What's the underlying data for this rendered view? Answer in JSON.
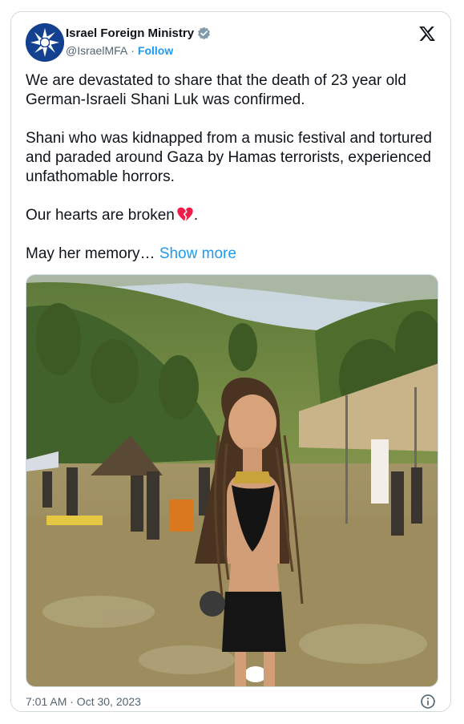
{
  "account": {
    "name": "Israel Foreign Ministry",
    "handle": "@IsraelMFA",
    "separator": "·",
    "follow_label": "Follow"
  },
  "tweet": {
    "paragraph1": "We are devastated to share that the death of 23 year old German-Israeli Shani Luk was confirmed.",
    "paragraph2": "Shani who was kidnapped from a music festival and tortured and paraded around Gaza by Hamas terrorists, experienced unfathomable horrors.",
    "paragraph3_text": "Our hearts are broken",
    "paragraph3_end": ".",
    "paragraph4_text": "May her memory…",
    "show_more_label": "Show more",
    "timestamp": "7:01 AM · Oct 30, 2023"
  },
  "icons": {
    "verified": "verified-badge-icon",
    "logo": "x-logo-icon",
    "info": "info-icon",
    "emoji": "broken-heart-icon"
  },
  "colors": {
    "link": "#1d9bf0",
    "text": "#0f1419",
    "secondary": "#536471",
    "border": "#cfd9de",
    "heart": "#f01d4a"
  }
}
